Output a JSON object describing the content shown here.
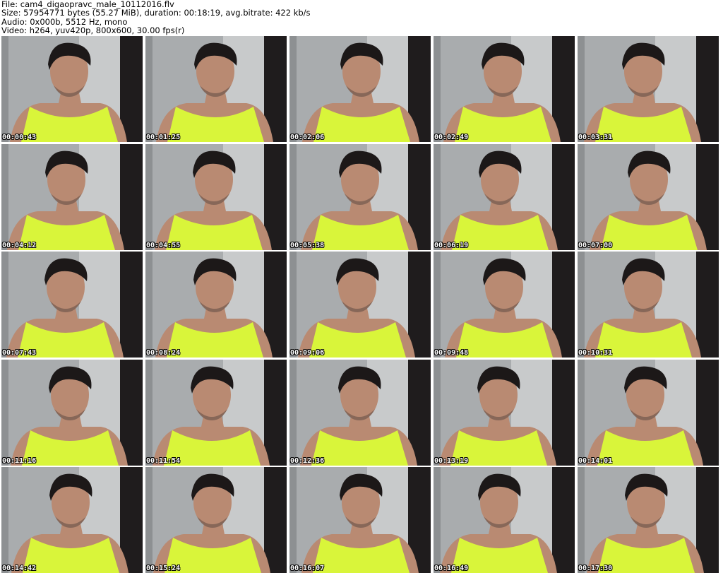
{
  "header": {
    "file": "File: cam4_digaopravc_male_10112016.flv",
    "size": "Size: 57954771 bytes (55.27 MiB), duration: 00:18:19, avg.bitrate: 422 kb/s",
    "audio": "Audio: 0x000b, 5512 Hz, mono",
    "video": "Video: h264, yuv420p, 800x600, 30.00 fps(r)"
  },
  "thumbnails": [
    {
      "timestamp": "00:00:43"
    },
    {
      "timestamp": "00:01:25"
    },
    {
      "timestamp": "00:02:06"
    },
    {
      "timestamp": "00:02:49"
    },
    {
      "timestamp": "00:03:31"
    },
    {
      "timestamp": "00:04:12"
    },
    {
      "timestamp": "00:04:55"
    },
    {
      "timestamp": "00:05:38"
    },
    {
      "timestamp": "00:06:19"
    },
    {
      "timestamp": "00:07:00"
    },
    {
      "timestamp": "00:07:43"
    },
    {
      "timestamp": "00:08:24"
    },
    {
      "timestamp": "00:09:06"
    },
    {
      "timestamp": "00:09:48"
    },
    {
      "timestamp": "00:10:31"
    },
    {
      "timestamp": "00:11:16"
    },
    {
      "timestamp": "00:11:54"
    },
    {
      "timestamp": "00:12:36"
    },
    {
      "timestamp": "00:13:19"
    },
    {
      "timestamp": "00:14:01"
    },
    {
      "timestamp": "00:14:42"
    },
    {
      "timestamp": "00:15:24"
    },
    {
      "timestamp": "00:16:07"
    },
    {
      "timestamp": "00:16:49"
    },
    {
      "timestamp": "00:17:30"
    }
  ],
  "colors": {
    "wall": "#a9acae",
    "wall_light": "#c8cacb",
    "dark_panel": "#1f1c1d",
    "shirt": "#d9f53a",
    "skin": "#b98a72",
    "hair": "#1c1818"
  }
}
